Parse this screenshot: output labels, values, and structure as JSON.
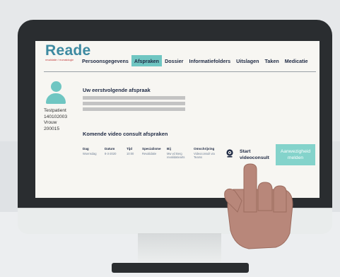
{
  "logo": {
    "name": "Reade",
    "tagline": "revalidatie / reumatologie"
  },
  "nav": {
    "items": [
      {
        "label": "Persoonsgegevens",
        "active": false
      },
      {
        "label": "Afspraken",
        "active": true
      },
      {
        "label": "Dossier",
        "active": false
      },
      {
        "label": "Informatiefolders",
        "active": false
      },
      {
        "label": "Uitslagen",
        "active": false
      },
      {
        "label": "Taken",
        "active": false
      },
      {
        "label": "Medicatie",
        "active": false
      }
    ]
  },
  "patient": {
    "name": "Testpatient",
    "number": "140102003",
    "gender": "Vrouw",
    "id": "200015"
  },
  "next_appointment": {
    "title": "Uw eerstvolgende afspraak"
  },
  "video_consults": {
    "title": "Komende video consult afspraken",
    "columns": [
      "Dag",
      "Datum",
      "Tijd",
      "Specialisme",
      "Bij",
      "Omschrijving"
    ],
    "row": {
      "dag": "Woensdag",
      "datum": "8-3-2020",
      "tijd": "10:00",
      "specialisme": "Revalidatie",
      "bij_line1": "Mw vd Berg",
      "bij_line2": "revalidatiearts",
      "omschrijving_line1": "Videoconsult via",
      "omschrijving_line2": "Teams"
    },
    "start_label_line1": "Start",
    "start_label_line2": "videoconsult",
    "aanwezigheid_line1": "Aanwezigheid",
    "aanwezigheid_line2": "melden"
  },
  "colors": {
    "accent": "#6fc6c2",
    "button": "#84d3cb",
    "brand_blue": "#3d8aa1",
    "brand_red": "#c23b3b",
    "nav_text": "#1f2a44"
  },
  "icons": [
    "patient-avatar-icon",
    "webcam-icon"
  ]
}
